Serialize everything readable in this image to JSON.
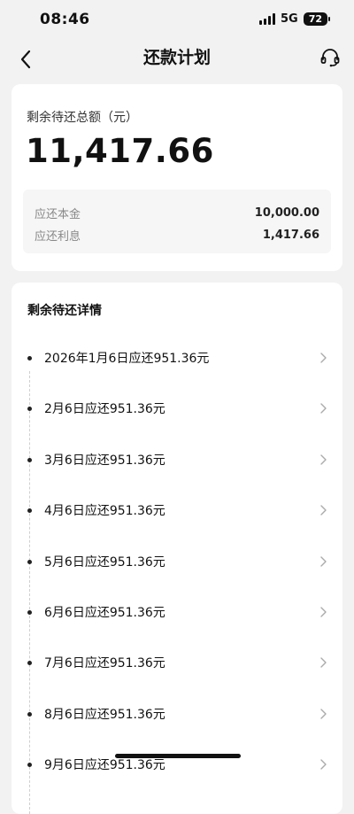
{
  "status_bar": {
    "time": "08:46",
    "network": "5G",
    "battery": "72"
  },
  "nav": {
    "title": "还款计划",
    "back_icon": "chevron-left-icon",
    "service_icon": "headset-icon"
  },
  "summary": {
    "label": "剩余待还总额（元）",
    "amount": "11,417.66",
    "principal_label": "应还本金",
    "principal_value": "10,000.00",
    "interest_label": "应还利息",
    "interest_value": "1,417.66"
  },
  "details": {
    "title": "剩余待还详情",
    "items": [
      {
        "text": "2026年1月6日应还951.36元"
      },
      {
        "text": "2月6日应还951.36元"
      },
      {
        "text": "3月6日应还951.36元"
      },
      {
        "text": "4月6日应还951.36元"
      },
      {
        "text": "5月6日应还951.36元"
      },
      {
        "text": "6月6日应还951.36元"
      },
      {
        "text": "7月6日应还951.36元"
      },
      {
        "text": "8月6日应还951.36元"
      },
      {
        "text": "9月6日应还951.36元"
      }
    ]
  },
  "colors": {
    "background": "#f2f2f2",
    "card": "#ffffff",
    "muted_text": "#888888"
  }
}
